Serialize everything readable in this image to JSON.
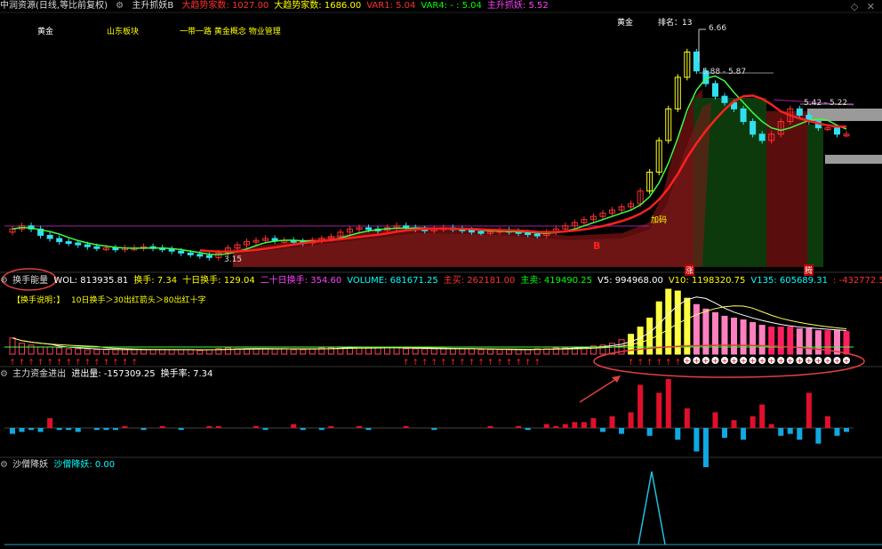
{
  "main_header": {
    "stock": "中润资源(日线,等比前复权)",
    "indicator": "主升抓妖B",
    "items": [
      {
        "label": "大趋势家数: 1027.00",
        "color": "#ff3030"
      },
      {
        "label": "大趋势家数: 1686.00",
        "color": "#ffff00"
      },
      {
        "label": "VAR1: 5.04",
        "color": "#ff3030"
      },
      {
        "label": "VAR4: - : 5.04",
        "color": "#00ff00"
      },
      {
        "label": "主升抓妖: 5.52",
        "color": "#ff40ff"
      }
    ]
  },
  "tags": [
    {
      "text": "黄金",
      "color": "#ffffff"
    },
    {
      "text": "山东板块",
      "color": "#ffff00"
    },
    {
      "text": "一带一路 黄金概念 物业管理",
      "color": "#ffff00"
    }
  ],
  "rank": {
    "sector": "黄金",
    "rank_label": "排名：13"
  },
  "price_labels": {
    "high": "6.66",
    "level1": "5.88 - 5.87",
    "level2": "5.42 - 5.22",
    "low": "3.15",
    "add_pos": "加码",
    "signal_b": "B",
    "tag_zhang": "涨",
    "tag_teng": "腾"
  },
  "vol_header": {
    "name": "换手能量",
    "items": [
      {
        "label": "WOL: 813935.81",
        "color": "#ffffff"
      },
      {
        "label": "换手: 7.34",
        "color": "#ffff00"
      },
      {
        "label": "十日换手: 129.04",
        "color": "#ffff00"
      },
      {
        "label": "二十日换手: 354.60",
        "color": "#ff40ff"
      },
      {
        "label": "VOLUME: 681671.25",
        "color": "#00ffff"
      },
      {
        "label": "主买: 262181.00",
        "color": "#ff3030"
      },
      {
        "label": "主卖: 419490.25",
        "color": "#00ff00"
      },
      {
        "label": "V5: 994968.00",
        "color": "#ffffff"
      },
      {
        "label": "V10: 1198320.75",
        "color": "#ffff00"
      },
      {
        "label": "V135: 605689.31",
        "color": "#00ffff"
      },
      {
        "label": ": -432772.50",
        "color": "#ff3030"
      }
    ]
  },
  "vol_note": {
    "title": "【换手说明：】",
    "rule1": "10日换手＞30出红箭头",
    "rule2": "＞80出红十字"
  },
  "capital_header": {
    "name": "主力资金进出",
    "items": [
      {
        "label": "进出量: -157309.25",
        "color": "#ffffff"
      },
      {
        "label": "换手率: 7.34",
        "color": "#ffffff"
      }
    ]
  },
  "bottom_header": {
    "name": "沙僧降妖",
    "items": [
      {
        "label": "沙僧降妖: 0.00",
        "color": "#00ffff"
      }
    ]
  },
  "chart_data": {
    "type": "candlestick",
    "price_range": [
      3.0,
      6.8
    ],
    "candles_close": [
      3.6,
      3.65,
      3.6,
      3.5,
      3.45,
      3.4,
      3.38,
      3.35,
      3.32,
      3.3,
      3.3,
      3.28,
      3.3,
      3.3,
      3.32,
      3.3,
      3.28,
      3.25,
      3.22,
      3.2,
      3.18,
      3.15,
      3.22,
      3.3,
      3.35,
      3.4,
      3.42,
      3.45,
      3.42,
      3.42,
      3.4,
      3.38,
      3.42,
      3.45,
      3.48,
      3.55,
      3.6,
      3.62,
      3.6,
      3.58,
      3.62,
      3.65,
      3.62,
      3.6,
      3.58,
      3.6,
      3.62,
      3.6,
      3.58,
      3.56,
      3.55,
      3.56,
      3.58,
      3.56,
      3.54,
      3.52,
      3.5,
      3.55,
      3.6,
      3.65,
      3.7,
      3.75,
      3.8,
      3.85,
      3.9,
      3.95,
      4.0,
      4.2,
      4.5,
      5.0,
      5.5,
      6.0,
      6.4,
      6.1,
      5.9,
      5.7,
      5.6,
      5.5,
      5.3,
      5.1,
      5.0,
      5.1,
      5.3,
      5.5,
      5.4,
      5.3,
      5.2,
      5.2,
      5.1,
      5.1
    ],
    "volume_bars": [
      18,
      12,
      10,
      8,
      8,
      7,
      6,
      6,
      5,
      5,
      5,
      5,
      5,
      5,
      5,
      5,
      5,
      5,
      5,
      5,
      4,
      5,
      6,
      7,
      6,
      6,
      6,
      6,
      6,
      6,
      5,
      5,
      6,
      7,
      7,
      8,
      8,
      8,
      7,
      7,
      7,
      7,
      6,
      6,
      6,
      6,
      6,
      6,
      6,
      6,
      5,
      5,
      5,
      5,
      5,
      5,
      6,
      6,
      7,
      7,
      8,
      8,
      9,
      10,
      12,
      16,
      22,
      30,
      40,
      58,
      72,
      70,
      62,
      55,
      50,
      46,
      42,
      40,
      38,
      35,
      32,
      30,
      30,
      30,
      28,
      28,
      26,
      26,
      26,
      25
    ],
    "capital_flow": [
      -3,
      -2,
      -1,
      -2,
      5,
      -1,
      -1,
      -2,
      0,
      -1,
      -1,
      -1,
      1,
      0,
      -1,
      0,
      1,
      0,
      -1,
      0,
      0,
      1,
      1,
      0,
      0,
      0,
      1,
      -1,
      0,
      0,
      2,
      -1,
      0,
      -1,
      1,
      0,
      0,
      1,
      -1,
      0,
      0,
      0,
      1,
      0,
      0,
      -1,
      0,
      0,
      0,
      0,
      0,
      1,
      0,
      0,
      1,
      -1,
      0,
      2,
      1,
      2,
      3,
      3,
      5,
      -2,
      6,
      -3,
      8,
      22,
      -4,
      18,
      25,
      -6,
      10,
      -12,
      -20,
      8,
      -5,
      4,
      -6,
      6,
      12,
      2,
      -4,
      -3,
      -6,
      18,
      -8,
      6,
      -4,
      -2
    ],
    "shaseng_value": 0.0,
    "shaseng_spike_index": 72
  }
}
